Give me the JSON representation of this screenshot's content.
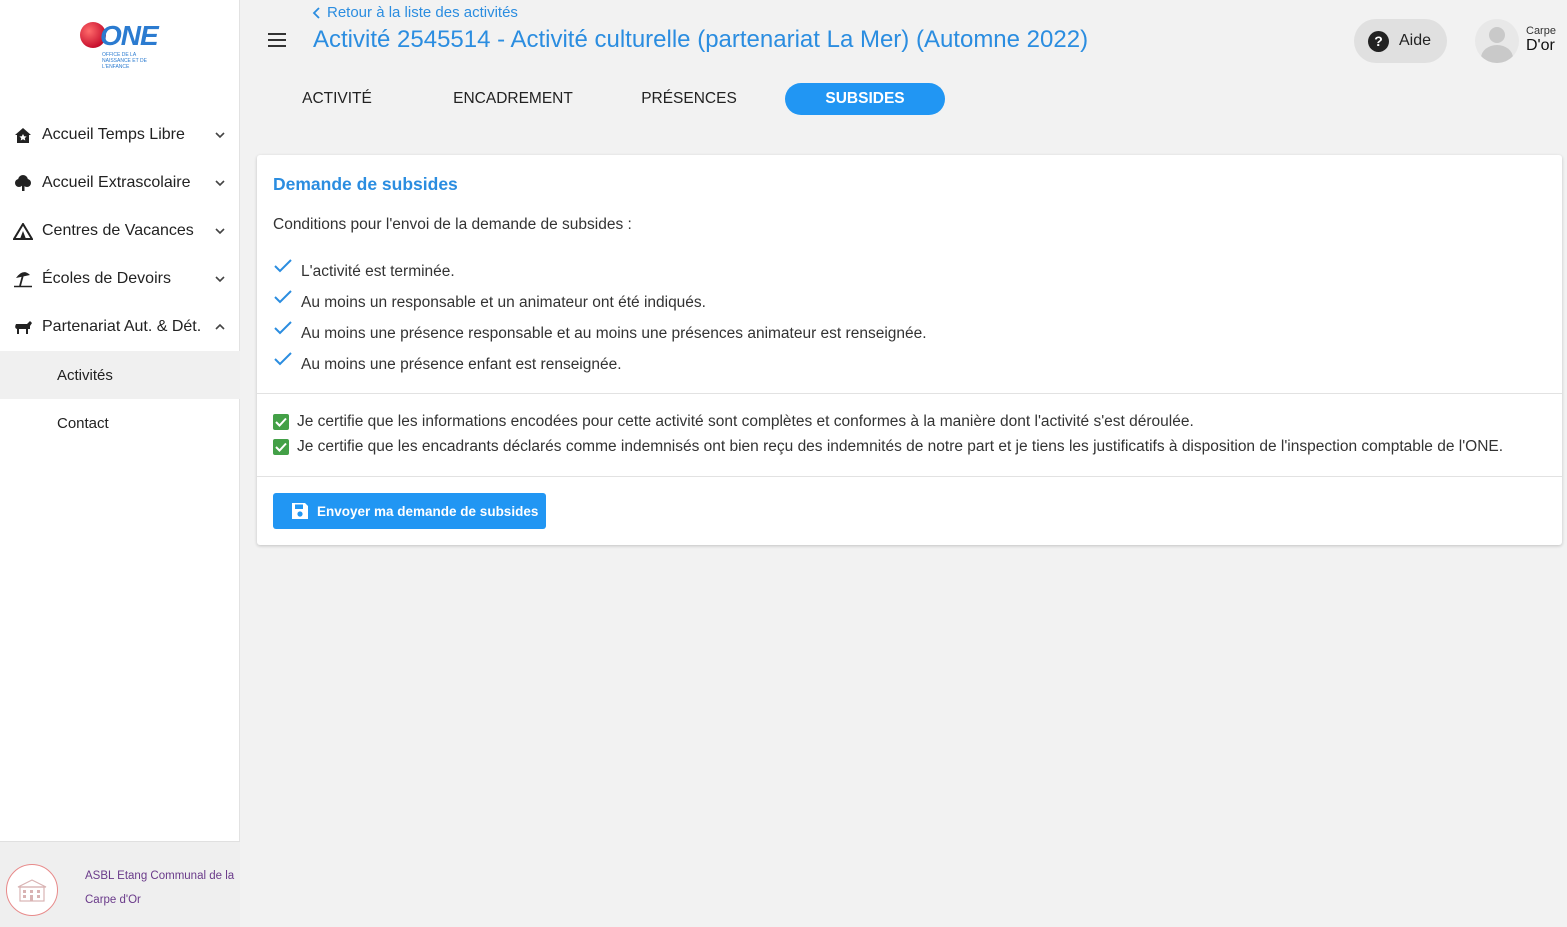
{
  "logo": {
    "text": "ONE",
    "subtitle": "OFFICE DE LA NAISSANCE ET DE L'ENFANCE"
  },
  "sidebar": {
    "items": [
      {
        "label": "Accueil Temps Libre",
        "icon": "house-icon",
        "expanded": false
      },
      {
        "label": "Accueil Extrascolaire",
        "icon": "tree-icon",
        "expanded": false
      },
      {
        "label": "Centres de Vacances",
        "icon": "tent-icon",
        "expanded": false
      },
      {
        "label": "Écoles de Devoirs",
        "icon": "beach-umbrella-icon",
        "expanded": false
      },
      {
        "label": "Partenariat Aut. & Dét.",
        "icon": "animal-icon",
        "expanded": true
      }
    ],
    "subitems": [
      {
        "label": "Activités",
        "active": true
      },
      {
        "label": "Contact",
        "active": false
      }
    ],
    "organization": "ASBL Etang Communal de la Carpe d'Or"
  },
  "header": {
    "back_link": "Retour à la liste des activités",
    "title": "Activité 2545514 - Activité culturelle (partenariat La Mer) (Automne 2022)",
    "help_label": "Aide",
    "user_first": "Carpe",
    "user_last": "D'or"
  },
  "tabs": [
    {
      "label": "Activité",
      "active": false
    },
    {
      "label": "Encadrement",
      "active": false
    },
    {
      "label": "Présences",
      "active": false
    },
    {
      "label": "Subsides",
      "active": true
    }
  ],
  "card": {
    "title": "Demande de subsides",
    "intro": "Conditions pour l'envoi de la demande de subsides :",
    "conditions": [
      "L'activité est terminée.",
      "Au moins un responsable et un animateur ont été indiqués.",
      "Au moins une présence responsable et au moins une présences animateur est renseignée.",
      "Au moins une présence enfant est renseignée."
    ],
    "certifications": [
      {
        "label": "Je certifie que les informations encodées pour cette activité sont complètes et conformes à la manière dont l'activité s'est déroulée.",
        "checked": true
      },
      {
        "label": "Je certifie que les encadrants déclarés comme indemnisés ont bien reçu des indemnités de notre part et je tiens les justificatifs à disposition de l'inspection comptable de l'ONE.",
        "checked": true
      }
    ],
    "submit_label": "Envoyer ma demande de subsides"
  },
  "colors": {
    "primary": "#2196f3",
    "link": "#2b8de0",
    "check_green": "#43a047"
  }
}
